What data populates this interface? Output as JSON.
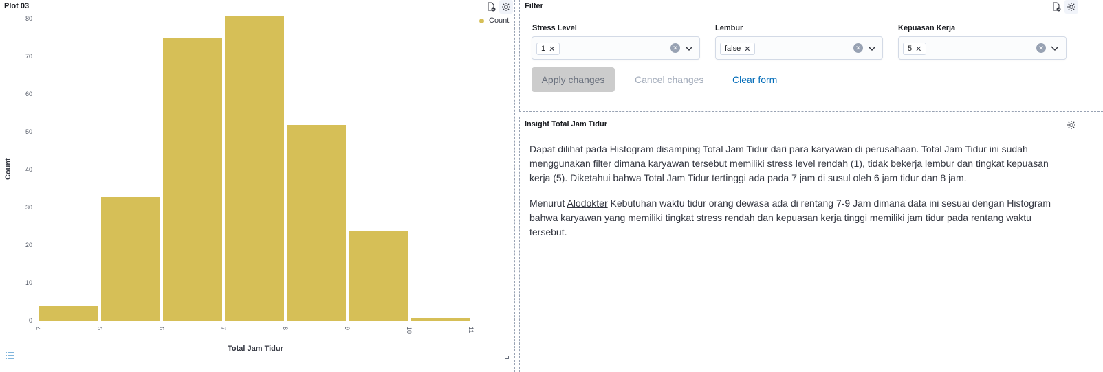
{
  "plot_panel": {
    "title": "Plot 03",
    "icons": [
      "file-check-icon",
      "gear-icon"
    ],
    "footer_icon": "list-icon"
  },
  "chart_data": {
    "type": "bar",
    "title": "",
    "xlabel": "Total Jam Tidur",
    "ylabel": "Count",
    "legend": [
      "Count"
    ],
    "legend_position": "top-right",
    "x_ticks": [
      "4",
      "5",
      "6",
      "7",
      "8",
      "9",
      "10",
      "11"
    ],
    "y_ticks": [
      "0",
      "10",
      "20",
      "30",
      "40",
      "50",
      "60",
      "70",
      "80"
    ],
    "ylim": [
      0,
      80
    ],
    "xlim": [
      4,
      11
    ],
    "bins": [
      {
        "x0": 4,
        "x1": 5,
        "value": 4
      },
      {
        "x0": 5,
        "x1": 6,
        "value": 33
      },
      {
        "x0": 6,
        "x1": 7,
        "value": 75
      },
      {
        "x0": 7,
        "x1": 8,
        "value": 81
      },
      {
        "x0": 8,
        "x1": 9,
        "value": 52
      },
      {
        "x0": 9,
        "x1": 10,
        "value": 24
      },
      {
        "x0": 10,
        "x1": 11,
        "value": 1
      }
    ],
    "color": "#d6bf57",
    "grid": false
  },
  "filter_panel": {
    "title": "Filter",
    "controls": [
      {
        "label": "Stress Level",
        "selected": "1"
      },
      {
        "label": "Lembur",
        "selected": "false"
      },
      {
        "label": "Kepuasan Kerja",
        "selected": "5"
      }
    ],
    "apply_label": "Apply changes",
    "cancel_label": "Cancel changes",
    "clear_label": "Clear form",
    "link_color": "#006bb8"
  },
  "insight_panel": {
    "title": "Insight Total Jam Tidur",
    "paragraph1": "Dapat dilihat pada Histogram disamping Total Jam Tidur dari para karyawan di perusahaan. Total Jam Tidur ini sudah menggunakan filter dimana karyawan tersebut memiliki stress level rendah (1), tidak bekerja lembur dan tingkat kepuasan kerja (5). Diketahui bahwa Total Jam Tidur tertinggi ada pada 7 jam di susul oleh 6 jam tidur dan 8 jam.",
    "paragraph2_prefix": "Menurut ",
    "paragraph2_link": "Alodokter",
    "paragraph2_suffix": " Kebutuhan waktu tidur orang dewasa ada di rentang 7-9 Jam dimana data ini sesuai dengan Histogram bahwa karyawan yang memiliki tingkat stress rendah dan kepuasan kerja tinggi memiliki jam tidur pada rentang waktu tersebut."
  }
}
